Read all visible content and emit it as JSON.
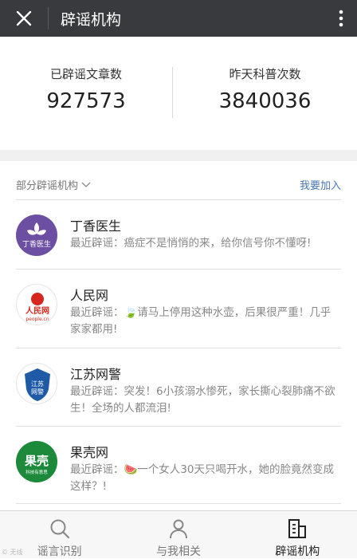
{
  "header": {
    "title": "辟谣机构",
    "close_icon": "close-icon",
    "more_icon": "more-vertical-icon"
  },
  "stats": {
    "left": {
      "label": "已辟谣文章数",
      "value": "927573"
    },
    "right": {
      "label": "昨天科普次数",
      "value": "3840036"
    }
  },
  "section": {
    "filter_label": "部分辟谣机构",
    "join_label": "我要加入"
  },
  "orgs": [
    {
      "name": "丁香医生",
      "recent": "最近辟谣：癌症不是悄悄的来，给你信号你不懂呀!",
      "logo_text": "丁香医生"
    },
    {
      "name": "人民网",
      "recent": "最近辟谣：🍃请马上停用这种水壶，后果很严重！几乎家家都用!",
      "logo_text": "人民网",
      "logo_sub": "people.cn"
    },
    {
      "name": "江苏网警",
      "recent": "最近辟谣：突发！6小孩溺水惨死，家长撕心裂肺痛不欲生！全场的人都流泪!",
      "logo_text": "江苏",
      "logo_sub": "网警"
    },
    {
      "name": "果壳网",
      "recent": "最近辟谣：🍉一个女人30天只喝开水，她的脸竟然变成这样？!",
      "logo_text": "果壳",
      "logo_sub": "科技有意思"
    }
  ],
  "tabs": [
    {
      "label": "谣言识别",
      "icon": "search-icon"
    },
    {
      "label": "与我相关",
      "icon": "person-icon"
    },
    {
      "label": "辟谣机构",
      "icon": "organization-icon"
    }
  ],
  "watermark": "© 无线"
}
